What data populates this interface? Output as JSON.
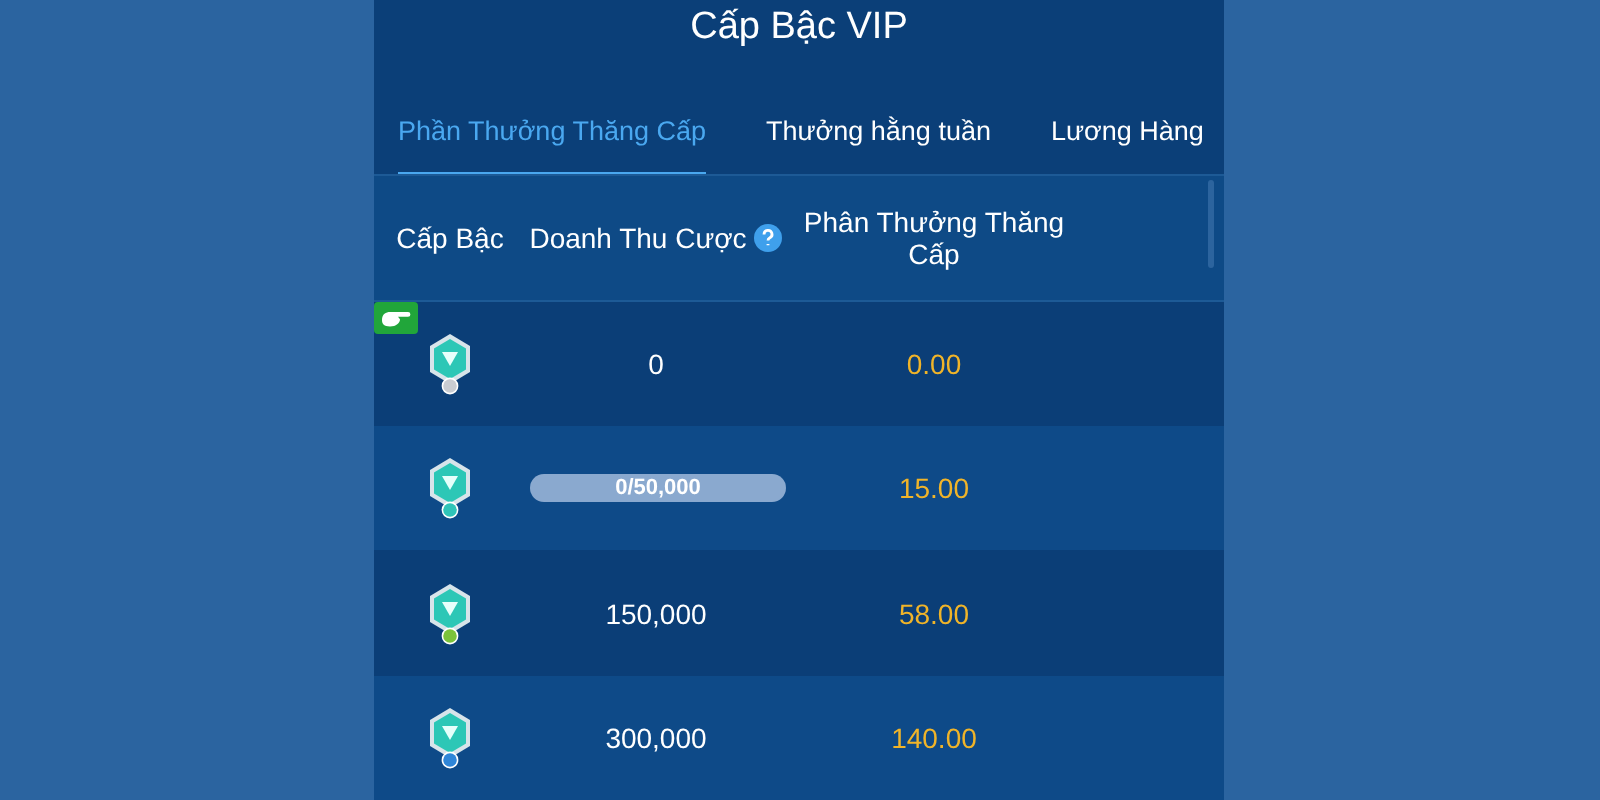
{
  "title": "Cấp Bậc VIP",
  "tabs": [
    {
      "label": "Phần Thưởng Thăng Cấp",
      "selected": true
    },
    {
      "label": "Thưởng hằng tuần",
      "selected": false
    },
    {
      "label": "Lương Hàng",
      "selected": false
    }
  ],
  "table": {
    "columns": [
      "Cấp Bậc",
      "Doanh Thu Cược",
      "Phân Thưởng Thăng Cấp"
    ],
    "rows": [
      {
        "color": "#c9ccd2",
        "current": true,
        "kind": "text",
        "revenue": "0",
        "reward": "0.00"
      },
      {
        "color": "#2fc4b8",
        "current": false,
        "kind": "progress",
        "revenue": "0/50,000",
        "level": 0,
        "reward": "15.00"
      },
      {
        "color": "#7bc23a",
        "current": false,
        "kind": "text",
        "revenue": "150,000",
        "reward": "58.00"
      },
      {
        "color": "#2f86d8",
        "current": false,
        "kind": "text",
        "revenue": "300,000",
        "reward": "140.00"
      }
    ]
  }
}
